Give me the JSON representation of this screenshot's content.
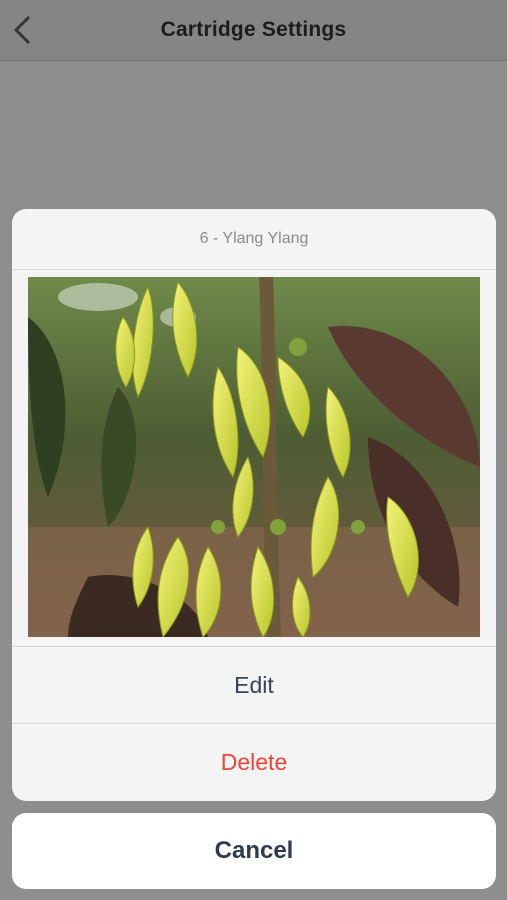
{
  "navbar": {
    "title": "Cartridge Settings",
    "back_icon": "chevron-left-icon"
  },
  "action_sheet": {
    "title": "6 - Ylang Ylang",
    "image_subject": "ylang ylang flowers",
    "actions": {
      "edit_label": "Edit",
      "delete_label": "Delete"
    },
    "cancel_label": "Cancel"
  },
  "colors": {
    "destructive": "#f0443a",
    "action_text": "#3a4456",
    "overlay": "#8e8e8e"
  }
}
